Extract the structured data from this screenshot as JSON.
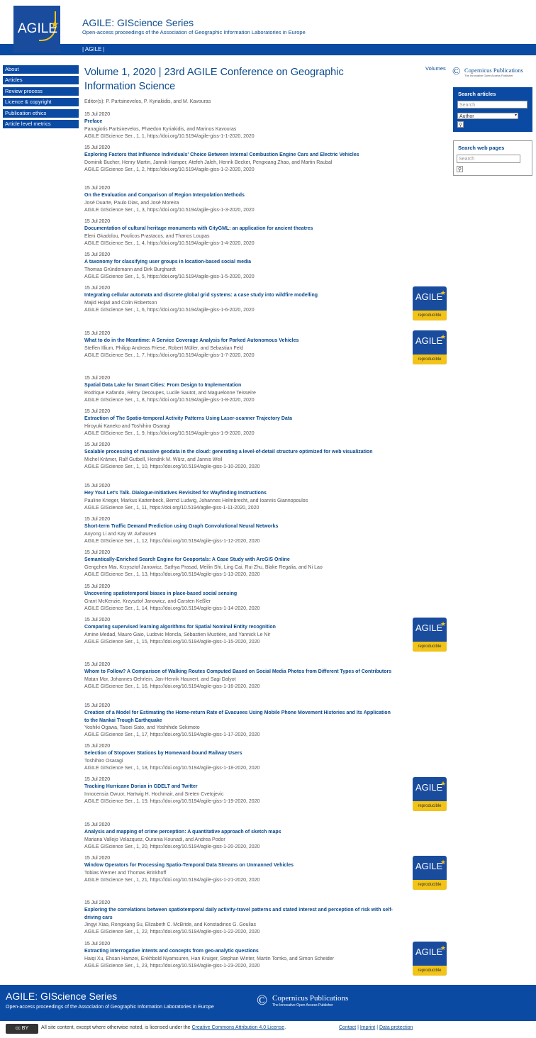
{
  "header": {
    "logo_text": "AGILE",
    "site_title": "AGILE: GIScience Series",
    "subtitle": "Open-access proceedings of the Association of Geographic Information Laboratories in Europe"
  },
  "navbar": {
    "link": "|  AGILE  |"
  },
  "sidebar": {
    "items": [
      "About",
      "Articles",
      "Review process",
      "Licence & copyright",
      "Publication ethics",
      "Article level metrics"
    ]
  },
  "main": {
    "volume_title": "Volume 1, 2020 | 23rd AGILE Conference on Geographic Information Science",
    "editors": "Editor(s): P. Partsinevelos, P. Kyriakidis, and M. Kavouras",
    "volumes_link": "Volumes",
    "badge_label": "AGILE",
    "badge_foot": "reproducible",
    "articles": [
      {
        "date": "15 Jul 2020",
        "title": "Preface",
        "authors": "Panagiotis Partsinevelos, Phaedon Kyriakidis, and Marinos Kavouras",
        "cite": "AGILE GIScience Ser., 1, 1, https://doi.org/10.5194/agile-giss-1-1-2020, 2020"
      },
      {
        "date": "15 Jul 2020",
        "title": "Exploring Factors that Influence Individuals' Choice Between Internal Combustion Engine Cars and Electric Vehicles",
        "authors": "Dominik Bucher, Henry Martin, Jannik Hamper, Atefeh Jaleh, Henrik Becker, Pengxiang Zhao, and Martin Raubal",
        "cite": "AGILE GIScience Ser., 1, 2, https://doi.org/10.5194/agile-giss-1-2-2020, 2020"
      },
      {
        "date": "15 Jul 2020",
        "title": "On the Evaluation and Comparison of Region Interpolation Methods",
        "authors": "José Duarte, Paulo Dias, and José Moreira",
        "cite": "AGILE GIScience Ser., 1, 3, https://doi.org/10.5194/agile-giss-1-3-2020, 2020"
      },
      {
        "date": "15 Jul 2020",
        "title": "Documentation of cultural heritage monuments with CityGML: an application for ancient theatres",
        "authors": "Eleni Gkadolou, Poulicos Prastacos, and Thanos Loupas",
        "cite": "AGILE GIScience Ser., 1, 4, https://doi.org/10.5194/agile-giss-1-4-2020, 2020"
      },
      {
        "date": "15 Jul 2020",
        "title": "A taxonomy for classifying user groups in location-based social media",
        "authors": "Thomas Gründemann and Dirk Burghardt",
        "cite": "AGILE GIScience Ser., 1, 5, https://doi.org/10.5194/agile-giss-1-5-2020, 2020"
      },
      {
        "date": "15 Jul 2020",
        "title": "Integrating cellular automata and discrete global grid systems: a case study into wildfire modelling",
        "authors": "Majid Hojati and Colin Robertson",
        "cite": "AGILE GIScience Ser., 1, 6, https://doi.org/10.5194/agile-giss-1-6-2020, 2020"
      },
      {
        "date": "15 Jul 2020",
        "title": "What to do in the Meantime: A Service Coverage Analysis for Parked Autonomous Vehicles",
        "authors": "Steffen Illium, Philipp Andreas Friese, Robert Müller, and Sebastian Feld",
        "cite": "AGILE GIScience Ser., 1, 7, https://doi.org/10.5194/agile-giss-1-7-2020, 2020"
      },
      {
        "date": "15 Jul 2020",
        "title": "Spatial Data Lake for Smart Cities: From Design to Implementation",
        "authors": "Rodrique Kafando, Rémy Decoupes, Lucile Sautot, and Maguelonne Teisseire",
        "cite": "AGILE GIScience Ser., 1, 8, https://doi.org/10.5194/agile-giss-1-8-2020, 2020"
      },
      {
        "date": "15 Jul 2020",
        "title": "Extraction of The Spatio-temporal Activity Patterns Using Laser-scanner Trajectory Data",
        "authors": "Hiroyuki Kaneko and Toshihiro Osaragi",
        "cite": "AGILE GIScience Ser., 1, 9, https://doi.org/10.5194/agile-giss-1-9-2020, 2020"
      },
      {
        "date": "15 Jul 2020",
        "title": "Scalable processing of massive geodata in the cloud: generating a level-of-detail structure optimized for web visualization",
        "authors": "Michel Krämer, Ralf Gutbell, Hendrik M. Würz, and Jannis Weil",
        "cite": "AGILE GIScience Ser., 1, 10, https://doi.org/10.5194/agile-giss-1-10-2020, 2020"
      },
      {
        "date": "15 Jul 2020",
        "title": "Hey You! Let's Talk. Dialogue-Initiatives Revisited for Wayfinding Instructions",
        "authors": "Pauline Krieger, Markus Kattenbeck, Bernd Ludwig, Johannes Helmbrecht, and Ioannis Giannopoulos",
        "cite": "AGILE GIScience Ser., 1, 11, https://doi.org/10.5194/agile-giss-1-11-2020, 2020"
      },
      {
        "date": "15 Jul 2020",
        "title": "Short-term Traffic Demand Prediction using Graph Convolutional Neural Networks",
        "authors": "Aoyong Li and Kay W. Axhausen",
        "cite": "AGILE GIScience Ser., 1, 12, https://doi.org/10.5194/agile-giss-1-12-2020, 2020"
      },
      {
        "date": "15 Jul 2020",
        "title": "Semantically-Enriched Search Engine for Geoportals: A Case Study with ArcGIS Online",
        "authors": "Gengchen Mai, Krzysztof Janowicz, Sathya Prasad, Meilin Shi, Ling Cai, Rui Zhu, Blake Regalia, and Ni Lao",
        "cite": "AGILE GIScience Ser., 1, 13, https://doi.org/10.5194/agile-giss-1-13-2020, 2020"
      },
      {
        "date": "15 Jul 2020",
        "title": "Uncovering spatiotemporal biases in place-based social sensing",
        "authors": "Grant McKenzie, Krzysztof Janowicz, and Carsten Keßler",
        "cite": "AGILE GIScience Ser., 1, 14, https://doi.org/10.5194/agile-giss-1-14-2020, 2020"
      },
      {
        "date": "15 Jul 2020",
        "title": "Comparing supervised learning algorithms for Spatial Nominal Entity recognition",
        "authors": "Amine Medad, Mauro Gaio, Ludovic Moncla, Sébastien Mustière, and Yannick Le Nir",
        "cite": "AGILE GIScience Ser., 1, 15, https://doi.org/10.5194/agile-giss-1-15-2020, 2020"
      },
      {
        "date": "15 Jul 2020",
        "title": "Whom to Follow? A Comparison of Walking Routes Computed Based on Social Media Photos from Different Types of Contributors",
        "authors": "Matan Mor, Johannes Oehrlein, Jan-Henrik Haunert, and Sagi Dalyot",
        "cite": "AGILE GIScience Ser., 1, 16, https://doi.org/10.5194/agile-giss-1-16-2020, 2020"
      },
      {
        "date": "15 Jul 2020",
        "title": "Creation of a Model for Estimating the Home-return Rate of Evacuees Using Mobile Phone Movement Histories and Its Application to the Nankai Trough Earthquake",
        "authors": "Yoshiki Ogawa, Taisei Sato, and Yoshihide Sekimoto",
        "cite": "AGILE GIScience Ser., 1, 17, https://doi.org/10.5194/agile-giss-1-17-2020, 2020"
      },
      {
        "date": "15 Jul 2020",
        "title": "Selection of Stopover Stations by Homeward-bound Railway Users",
        "authors": "Toshihiro Osaragi",
        "cite": "AGILE GIScience Ser., 1, 18, https://doi.org/10.5194/agile-giss-1-18-2020, 2020"
      },
      {
        "date": "15 Jul 2020",
        "title": "Tracking Hurricane Dorian in GDELT and Twitter",
        "authors": "Innocensia Owuor, Hartwig H. Hochmair, and Sreten Cvetojevic",
        "cite": "AGILE GIScience Ser., 1, 19, https://doi.org/10.5194/agile-giss-1-19-2020, 2020"
      },
      {
        "date": "15 Jul 2020",
        "title": "Analysis and mapping of crime perception: A quantitative approach of sketch maps",
        "authors": "Mariana Vallejo Velazquez, Ourania Kounadi, and Andrea Podor",
        "cite": "AGILE GIScience Ser., 1, 20, https://doi.org/10.5194/agile-giss-1-20-2020, 2020"
      },
      {
        "date": "15 Jul 2020",
        "title": "Window Operators for Processing Spatio-Temporal Data Streams on Unmanned Vehicles",
        "authors": "Tobias Werner and Thomas Brinkhoff",
        "cite": "AGILE GIScience Ser., 1, 21, https://doi.org/10.5194/agile-giss-1-21-2020, 2020"
      },
      {
        "date": "15 Jul 2020",
        "title": "Exploring the correlations between spatiotemporal daily activity-travel patterns and stated interest and perception of risk with self-driving cars",
        "authors": "Jingyi Xiao, Rongxiang Su, Elizabeth C. McBride, and Konstadinos G. Goulias",
        "cite": "AGILE GIScience Ser., 1, 22, https://doi.org/10.5194/agile-giss-1-22-2020, 2020"
      },
      {
        "date": "15 Jul 2020",
        "title": "Extracting interrogative intents and concepts from geo-analytic questions",
        "authors": "Haiqi Xu, Ehsan Hamzei, Enkhbold Nyamsuren, Han Kruiger, Stephan Winter, Martin Tomko, and Simon Scheider",
        "cite": "AGILE GIScience Ser., 1, 23, https://doi.org/10.5194/agile-giss-1-23-2020, 2020"
      }
    ]
  },
  "right": {
    "copernicus_name": "Copernicus Publications",
    "copernicus_tag": "The Innovative Open Access Publisher",
    "search_articles_label": "Search articles",
    "search_placeholder": "Search",
    "search_select_value": "Author",
    "search_web_label": "Search web pages",
    "web_placeholder": "Search"
  },
  "footer": {
    "title": "AGILE: GIScience Series",
    "subtitle": "Open-access proceedings of the Association of Geographic Information Laboratories in Europe",
    "copernicus_name": "Copernicus Publications",
    "copernicus_tag": "The Innovative Open Access Publisher",
    "cc_badge": "cc BY",
    "licence_text": "All site content, except where otherwise noted, is licensed under the",
    "licence_link": "Creative Commons Attribution 4.0 License",
    "links": [
      "Contact",
      "Imprint",
      "Data protection"
    ]
  },
  "colors": {
    "brand": "#0b4aa3",
    "accent": "#f2c318"
  }
}
